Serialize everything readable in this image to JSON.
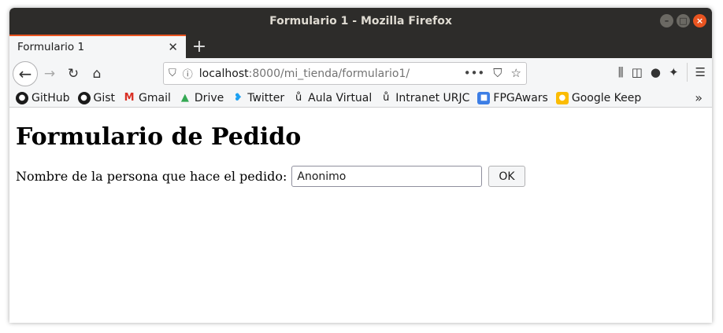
{
  "window": {
    "title": "Formulario 1 - Mozilla Firefox"
  },
  "tabs": [
    {
      "label": "Formulario 1"
    }
  ],
  "url": {
    "host": "localhost",
    "path": ":8000/mi_tienda/formulario1/"
  },
  "bookmarks": [
    {
      "label": "GitHub",
      "icon": "github-icon",
      "color": "#1b1b1b"
    },
    {
      "label": "Gist",
      "icon": "github-icon",
      "color": "#1b1b1b"
    },
    {
      "label": "Gmail",
      "icon": "gmail-icon",
      "color": "#d93025"
    },
    {
      "label": "Drive",
      "icon": "drive-icon",
      "color": "#34a853"
    },
    {
      "label": "Twitter",
      "icon": "twitter-icon",
      "color": "#1da1f2"
    },
    {
      "label": "Aula Virtual",
      "icon": "urjc-icon",
      "color": "#c8102e"
    },
    {
      "label": "Intranet URJC",
      "icon": "urjc-icon",
      "color": "#c8102e"
    },
    {
      "label": "FPGAwars",
      "icon": "fpgawars-icon",
      "color": "#3d7ee5"
    },
    {
      "label": "Google Keep",
      "icon": "keep-icon",
      "color": "#fbbc04"
    }
  ],
  "page": {
    "heading": "Formulario de Pedido",
    "field_label": "Nombre de la persona que hace el pedido:",
    "field_value": "Anonimo",
    "submit_label": "OK"
  },
  "colors": {
    "accent": "#e95420",
    "titlebar": "#2d2c2a"
  }
}
